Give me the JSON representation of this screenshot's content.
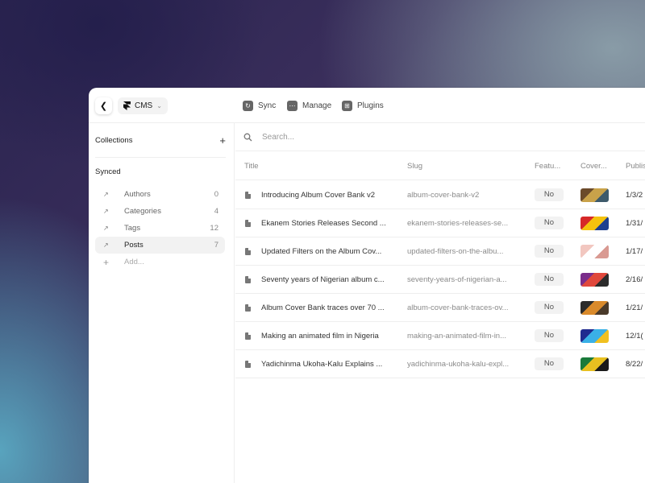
{
  "toolbar": {
    "cms_label": "CMS",
    "sync_label": "Sync",
    "manage_label": "Manage",
    "plugins_label": "Plugins"
  },
  "sidebar": {
    "collections_label": "Collections",
    "synced_label": "Synced",
    "items": [
      {
        "label": "Authors",
        "count": "0"
      },
      {
        "label": "Categories",
        "count": "4"
      },
      {
        "label": "Tags",
        "count": "12"
      },
      {
        "label": "Posts",
        "count": "7"
      }
    ],
    "add_label": "Add..."
  },
  "search": {
    "placeholder": "Search..."
  },
  "table": {
    "columns": [
      "Title",
      "Slug",
      "Featu...",
      "Cover...",
      "Publis"
    ],
    "rows": [
      {
        "title": "Introducing Album Cover Bank v2",
        "slug": "album-cover-bank-v2",
        "featured": "No",
        "date": "1/3/2"
      },
      {
        "title": "Ekanem Stories Releases Second ...",
        "slug": "ekanem-stories-releases-se...",
        "featured": "No",
        "date": "1/31/"
      },
      {
        "title": "Updated Filters on the Album Cov...",
        "slug": "updated-filters-on-the-albu...",
        "featured": "No",
        "date": "1/17/"
      },
      {
        "title": "Seventy years of Nigerian album c...",
        "slug": "seventy-years-of-nigerian-a...",
        "featured": "No",
        "date": "2/16/"
      },
      {
        "title": "Album Cover Bank traces over 70 ...",
        "slug": "album-cover-bank-traces-ov...",
        "featured": "No",
        "date": "1/21/"
      },
      {
        "title": "Making an animated film in Nigeria",
        "slug": "making-an-animated-film-in...",
        "featured": "No",
        "date": "12/1("
      },
      {
        "title": "Yadichinma Ukoha-Kalu Explains ...",
        "slug": "yadichinma-ukoha-kalu-expl...",
        "featured": "No",
        "date": "8/22/"
      }
    ]
  },
  "thumb_colors": [
    [
      "#6b4a2a",
      "#c9a24a",
      "#3d5a6b"
    ],
    [
      "#d62828",
      "#f4c20d",
      "#1d3f8f"
    ],
    [
      "#f2c7c0",
      "#ffffff",
      "#d99a92"
    ],
    [
      "#7a2d8a",
      "#e0483c",
      "#2b2b2b"
    ],
    [
      "#2b2b2b",
      "#d98a2b",
      "#4a3a2a"
    ],
    [
      "#1f2a8f",
      "#3ab0e6",
      "#f0c020"
    ],
    [
      "#1a7a3a",
      "#e8c020",
      "#1a1a1a"
    ]
  ]
}
